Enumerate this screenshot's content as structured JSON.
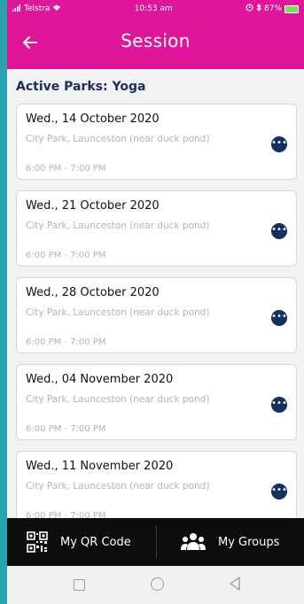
{
  "status_bar": {
    "carrier": "Telstra",
    "time": "10:53 am",
    "battery": "87%"
  },
  "header": {
    "title": "Session"
  },
  "group": {
    "title": "Active Parks: Yoga"
  },
  "sessions": [
    {
      "date": "Wed., 14 October 2020",
      "location": "City Park, Launceston (near duck pond)",
      "time": "6:00 PM  -  7:00 PM"
    },
    {
      "date": "Wed., 21 October 2020",
      "location": "City Park, Launceston (near duck pond)",
      "time": "6:00 PM  -  7:00 PM"
    },
    {
      "date": "Wed., 28 October 2020",
      "location": "City Park, Launceston (near duck pond)",
      "time": "6:00 PM  -  7:00 PM"
    },
    {
      "date": "Wed., 04 November 2020",
      "location": "City Park, Launceston (near duck pond)",
      "time": "6:00 PM  -  7:00 PM"
    },
    {
      "date": "Wed., 11 November 2020",
      "location": "City Park, Launceston (near duck pond)",
      "time": "6:00 PM  -  7:00 PM"
    }
  ],
  "bottom_bar": {
    "qr_label": "My QR Code",
    "groups_label": "My Groups"
  },
  "icons": {
    "back": "arrow-left-icon",
    "more": "more-horizontal-icon",
    "qr": "qr-code-icon",
    "groups": "users-icon"
  },
  "colors": {
    "primary": "#e0169a",
    "navy": "#14305e",
    "outer": "#2aa3b0"
  }
}
